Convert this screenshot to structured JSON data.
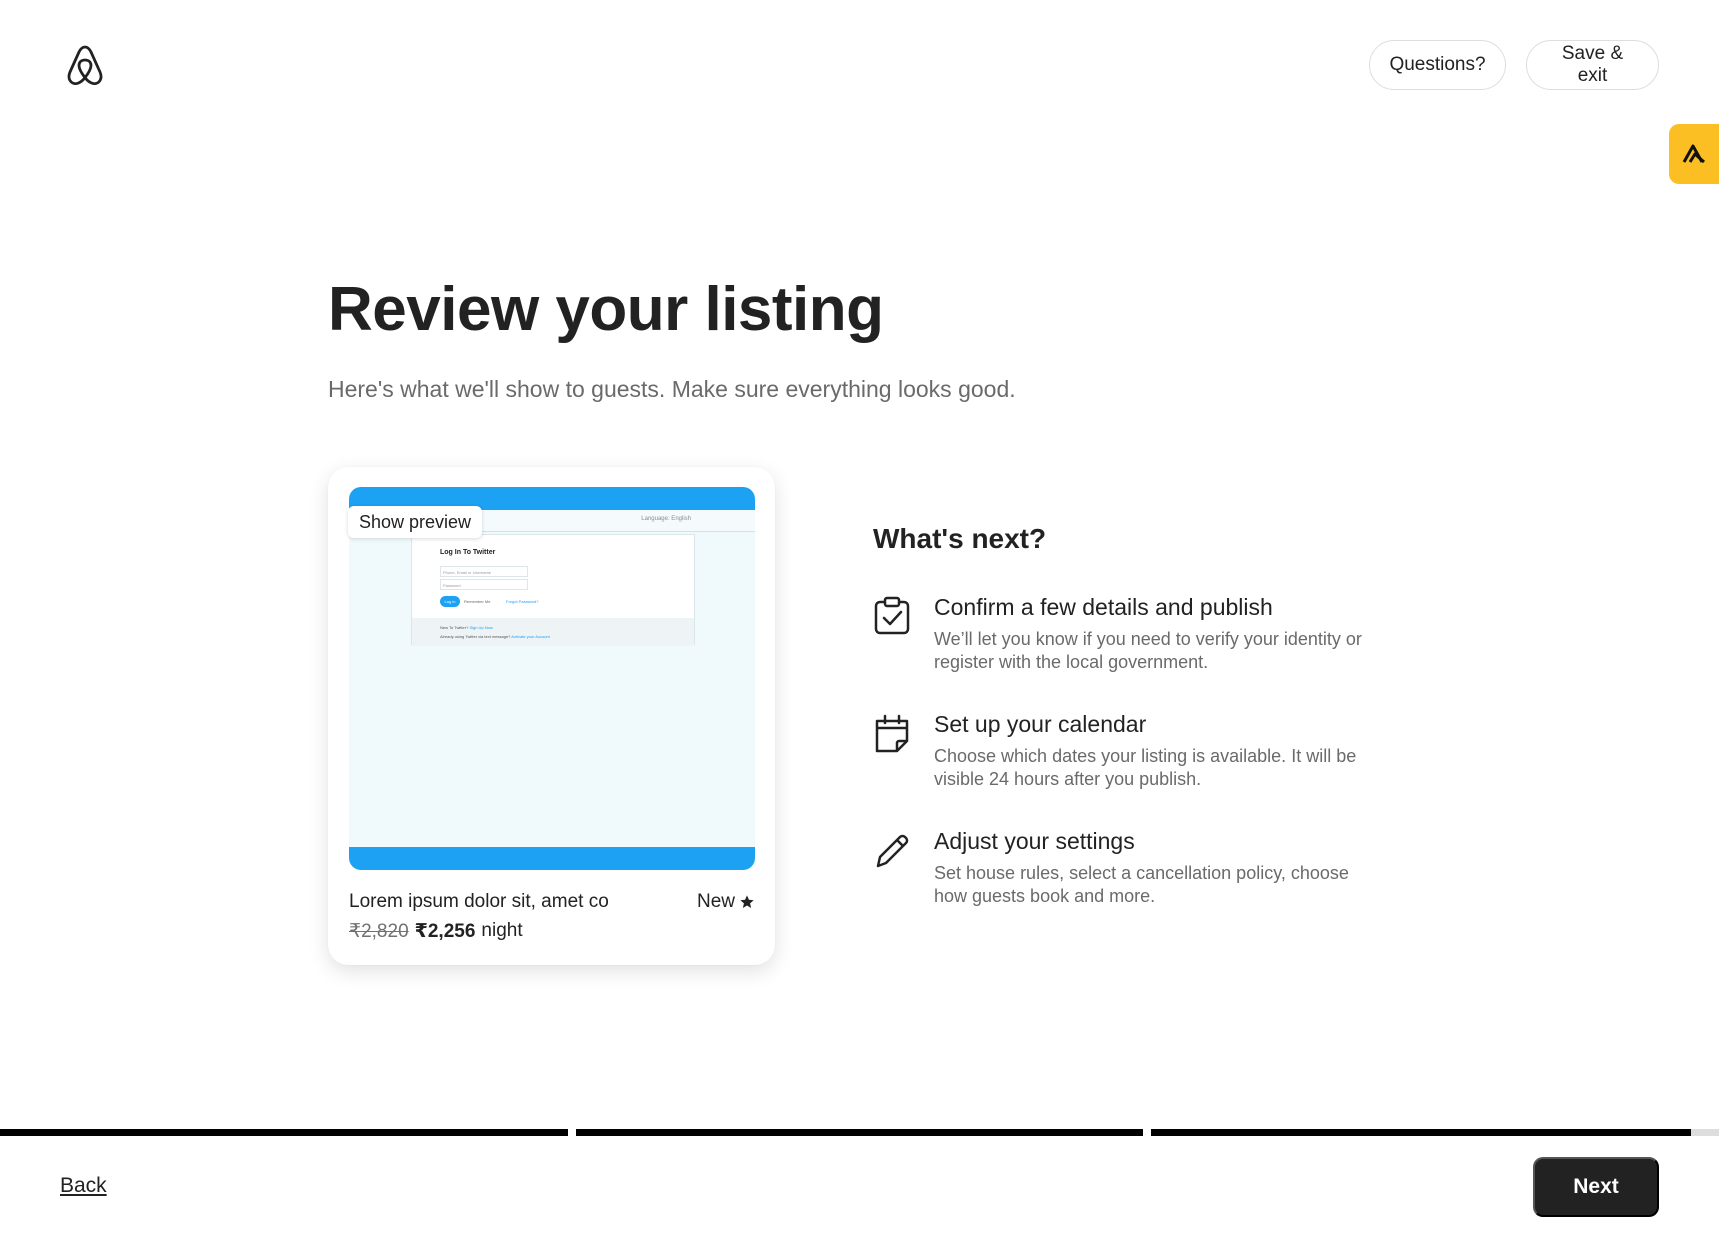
{
  "header": {
    "logo_icon": "airbnb-logo-icon",
    "questions_label": "Questions?",
    "save_exit_label": "Save & exit",
    "extension_icon": "extension-logo-icon",
    "extension_color": "#fbbf24"
  },
  "main": {
    "title": "Review your listing",
    "subtitle": "Here's what we'll show to guests. Make sure everything looks good."
  },
  "listing_card": {
    "preview_label": "Show preview",
    "image_preview": {
      "language_text": "Language: English",
      "login_title": "Log In To Twitter",
      "field1_placeholder": "Phone, Email or Username",
      "field2_placeholder": "Password",
      "login_button": "Log in",
      "remember_text": "Remember Me",
      "forgot_text": "Forgot Password?",
      "footer_line1_text": "New To Twitter?",
      "footer_line1_link": "Sign Up Now",
      "footer_line2_text": "Already using Twitter via text message?",
      "footer_line2_link": "Activate your Account",
      "accent_color": "#1da1f2"
    },
    "title": "Lorem ipsum dolor sit, amet co",
    "rating_label": "New",
    "rating_icon": "star-icon",
    "old_price": "₹2,820",
    "new_price": "₹2,256",
    "price_unit": "night"
  },
  "whats_next": {
    "heading": "What's next?",
    "steps": [
      {
        "icon": "clipboard-check-icon",
        "title": "Confirm a few details and publish",
        "description": "We’ll let you know if you need to verify your identity or register with the local government."
      },
      {
        "icon": "calendar-icon",
        "title": "Set up your calendar",
        "description": "Choose which dates your listing is available. It will be visible 24 hours after you publish."
      },
      {
        "icon": "pencil-icon",
        "title": "Adjust your settings",
        "description": "Set house rules, select a cancellation policy, choose how guests book and more."
      }
    ]
  },
  "progress": {
    "segments": [
      1.0,
      1.0,
      0.95
    ]
  },
  "footer": {
    "back_label": "Back",
    "next_label": "Next"
  }
}
